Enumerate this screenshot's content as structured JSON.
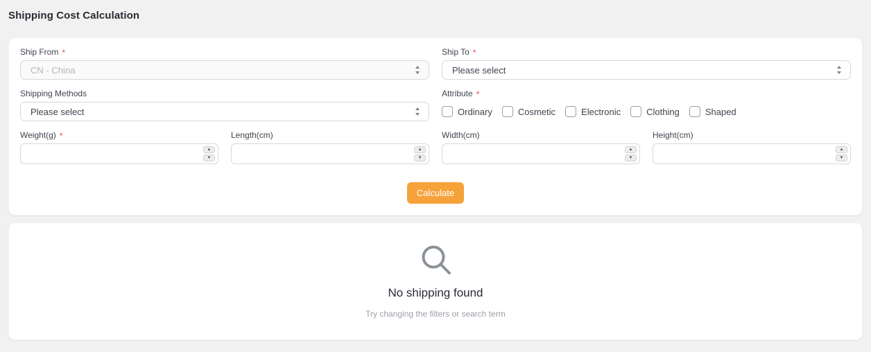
{
  "page": {
    "title": "Shipping Cost Calculation"
  },
  "form": {
    "required_marker": "*",
    "fields": {
      "ship_from": {
        "label": "Ship From",
        "required": true,
        "value": "CN - China",
        "disabled": true
      },
      "ship_to": {
        "label": "Ship To",
        "required": true,
        "value": "Please select"
      },
      "shipping_methods": {
        "label": "Shipping Methods",
        "required": false,
        "value": "Please select"
      },
      "attribute": {
        "label": "Attribute",
        "required": true,
        "options": [
          "Ordinary",
          "Cosmetic",
          "Electronic",
          "Clothing",
          "Shaped"
        ],
        "checked": [
          false,
          false,
          false,
          false,
          false
        ]
      },
      "weight": {
        "label": "Weight(g)",
        "required": true,
        "value": ""
      },
      "length": {
        "label": "Length(cm)",
        "required": false,
        "value": ""
      },
      "width": {
        "label": "Width(cm)",
        "required": false,
        "value": ""
      },
      "height": {
        "label": "Height(cm)",
        "required": false,
        "value": ""
      }
    },
    "calculate_label": "Calculate",
    "spinner": {
      "up": "▲",
      "down": "▼"
    }
  },
  "empty_state": {
    "icon": "search-icon",
    "title": "No shipping found",
    "subtitle": "Try changing the filters or search term"
  },
  "icons": {
    "select_arrow": "updown-arrow-icon",
    "empty_state": "search-icon"
  },
  "colors": {
    "accent_button": "#f6a23b",
    "required_asterisk": "#ef4444",
    "page_background": "#f1f1f2",
    "card_background": "#ffffff",
    "border": "#d8d8dd",
    "disabled_text": "#b2b5bd",
    "empty_icon": "#8b9199"
  }
}
